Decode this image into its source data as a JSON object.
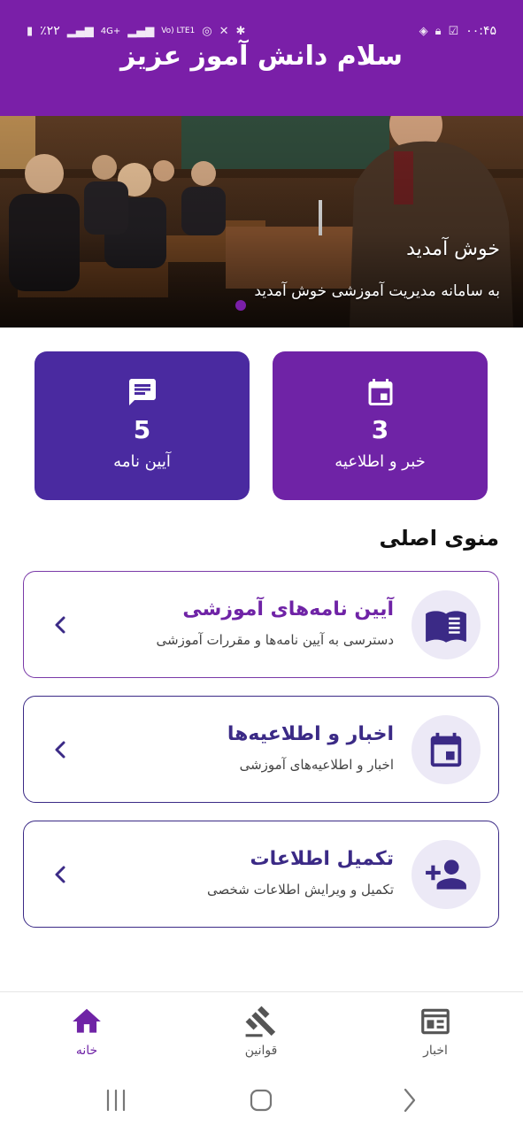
{
  "status_bar": {
    "time": "۰۰:۴۵",
    "battery": "٪۲۲",
    "network_labels": [
      "4G+",
      "Vo) LTE1"
    ]
  },
  "header": {
    "title": "سلام دانش آموز عزیز"
  },
  "hero": {
    "title": "خوش آمدید",
    "subtitle": "به سامانه مدیریت آموزشی خوش آمدید"
  },
  "stats": [
    {
      "value": "5",
      "label": "آیین نامه",
      "icon": "chat-icon"
    },
    {
      "value": "3",
      "label": "خبر و اطلاعیه",
      "icon": "calendar-icon"
    }
  ],
  "section": {
    "title": "منوی اصلی"
  },
  "menu": [
    {
      "title": "آیین نامه‌های آموزشی",
      "subtitle": "دسترسی به آیین نامه‌ها و مقررات آموزشی",
      "icon": "book-icon",
      "title_color": "#6f23a6"
    },
    {
      "title": "اخبار و اطلاعیه‌ها",
      "subtitle": "اخبار و اطلاعیه‌های آموزشی",
      "icon": "calendar-icon",
      "title_color": "#3b2a86"
    },
    {
      "title": "تکمیل اطلاعات",
      "subtitle": "تکمیل و ویرایش اطلاعات شخصی",
      "icon": "add-user-icon",
      "title_color": "#3b2a86"
    }
  ],
  "bottom_nav": {
    "home": "خانه",
    "rules": "قوانین",
    "news": "اخبار"
  },
  "colors": {
    "primary": "#7a1fa8",
    "indigo": "#4a2aa0",
    "purple": "#6f23a6",
    "dark_indigo": "#3b2a86"
  }
}
